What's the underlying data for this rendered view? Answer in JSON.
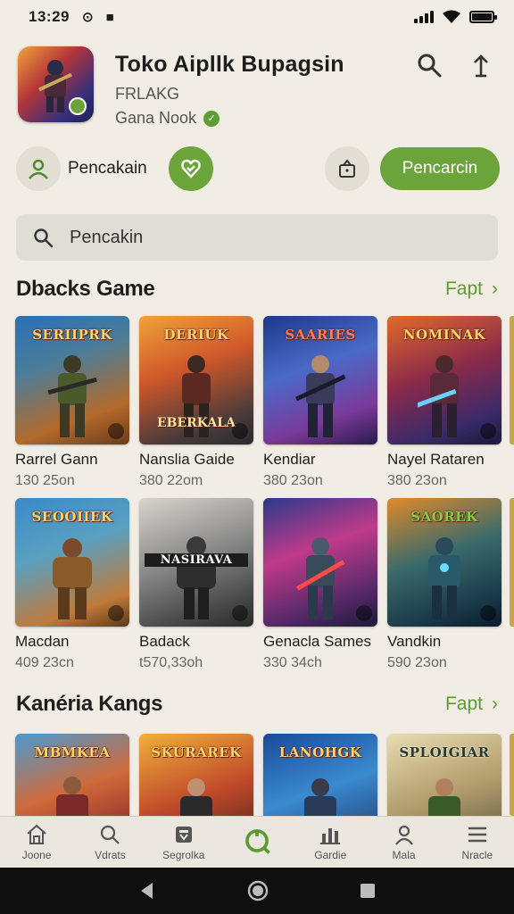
{
  "status": {
    "time": "13:29"
  },
  "app": {
    "title": "Toko Aipllk Bupagsin",
    "developer": "FRLAKG",
    "publisher": "Gana Nook"
  },
  "actions": {
    "profile_label": "Pencakain",
    "primary_label": "Pencarcin"
  },
  "search": {
    "placeholder": "Pencakin"
  },
  "sections": [
    {
      "title": "Dbacks Game",
      "see_all": "Fapt",
      "rows": [
        [
          {
            "logo": "SERIIPRK",
            "logo2": "",
            "name": "Rarrel Gann",
            "size": "130 25on"
          },
          {
            "logo": "DERIUK",
            "logo2": "EBERKALA",
            "name": "Nanslia Gaide",
            "size": "380 22om"
          },
          {
            "logo": "SAARIES",
            "logo2": "",
            "name": "Kendiar",
            "size": "380 23on"
          },
          {
            "logo": "NOMINAK",
            "logo2": "",
            "name": "Nayel Rataren",
            "size": "380 23on"
          }
        ],
        [
          {
            "logo": "SEOOIIEK",
            "logo2": "",
            "name": "Macdan",
            "size": "409 23cn"
          },
          {
            "logo": "NASIRAVA",
            "logo2": "",
            "name": "Badack",
            "size": "t570,33oh"
          },
          {
            "logo": "",
            "logo2": "",
            "name": "Genacla Sames",
            "size": "330 34ch"
          },
          {
            "logo": "SAOREK",
            "logo2": "",
            "name": "Vandkin",
            "size": "590 23on"
          }
        ]
      ]
    },
    {
      "title": "Kanéria Kangs",
      "see_all": "Fapt",
      "rows": [
        [
          {
            "logo": "MBMKEA",
            "logo2": "",
            "name": "",
            "size": ""
          },
          {
            "logo": "SKURAREK",
            "logo2": "",
            "name": "",
            "size": ""
          },
          {
            "logo": "LANOHGK",
            "logo2": "",
            "name": "",
            "size": ""
          },
          {
            "logo": "SPLOIGIAR",
            "logo2": "",
            "name": "",
            "size": ""
          }
        ]
      ]
    }
  ],
  "bottom_nav": [
    {
      "label": "Joone",
      "icon": "home-icon"
    },
    {
      "label": "Vdrats",
      "icon": "search-icon"
    },
    {
      "label": "Segrolka",
      "icon": "store-icon"
    },
    {
      "label": "",
      "icon": "refresh-icon"
    },
    {
      "label": "Gardie",
      "icon": "chart-icon"
    },
    {
      "label": "Mala",
      "icon": "person-icon"
    },
    {
      "label": "Nracle",
      "icon": "menu-icon"
    }
  ],
  "colors": {
    "accent": "#6ba43a",
    "background": "#f1ede4",
    "link": "#5e9a33"
  }
}
